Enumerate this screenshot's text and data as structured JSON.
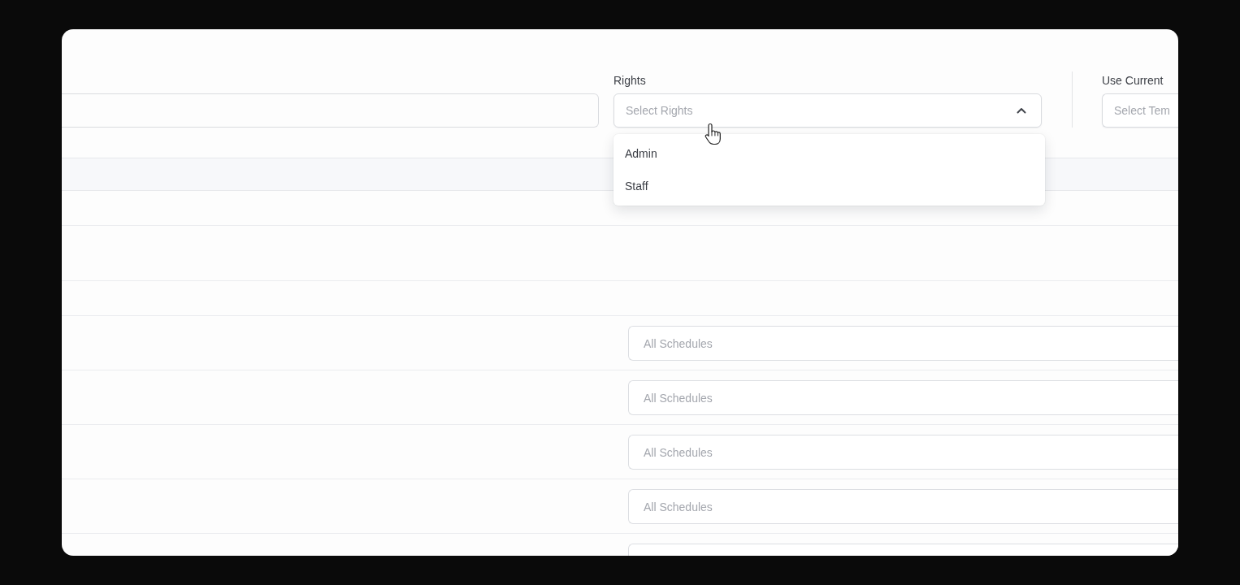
{
  "filters": [
    {
      "kind": "text"
    },
    {
      "kind": "select",
      "label": "Rights",
      "placeholder": "Select Rights",
      "expanded": true,
      "options": [
        {
          "label": "Admin",
          "selected": false
        },
        {
          "label": "Staff",
          "selected": false
        }
      ]
    },
    {
      "kind": "select",
      "label": "Use Current",
      "placeholder": "Select Tem",
      "separated": true
    }
  ],
  "table": {
    "rows": [
      {
        "kind": "group"
      },
      {
        "kind": "plain"
      },
      {
        "kind": "group"
      },
      {
        "kind": "schedule",
        "placeholder": "All Schedules"
      },
      {
        "kind": "schedule",
        "placeholder": "All Schedules"
      },
      {
        "kind": "schedule",
        "placeholder": "All Schedules"
      },
      {
        "kind": "schedule",
        "placeholder": "All Schedules"
      },
      {
        "kind": "schedule"
      }
    ]
  }
}
